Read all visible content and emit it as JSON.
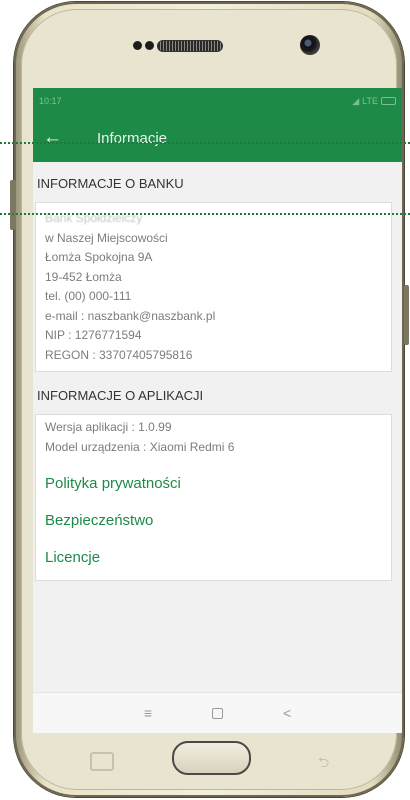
{
  "status_bar": {
    "time": "10:17",
    "network": "LTE"
  },
  "app_bar": {
    "back_label": "←",
    "title": "Informacje"
  },
  "bank_info": {
    "header": "INFORMACJE O BANKU",
    "lines": [
      "Bank Spółdzielczy",
      "w Naszej Miejscowości",
      "Łomża Spokojna 9A",
      "19-452 Łomża",
      "tel. (00) 000-111",
      "e-mail : naszbank@naszbank.pl",
      "NIP : 1276771594",
      "REGON : 33707405795816"
    ]
  },
  "app_info": {
    "header": "INFORMACJE O APLIKACJI",
    "version": "Wersja aplikacji : 1.0.99",
    "device": "Model urządzenia : Xiaomi Redmi 6",
    "links": {
      "privacy": "Polityka prywatności",
      "security": "Bezpieczeństwo",
      "licenses": "Licencje"
    }
  },
  "nav_bar": {
    "menu": "≡",
    "back": "<"
  },
  "hardware": {
    "back_glyph": "⮌"
  },
  "colors": {
    "accent": "#1e8a48",
    "phone_body": "#e9e4cf",
    "guide": "#1e7a3a"
  }
}
